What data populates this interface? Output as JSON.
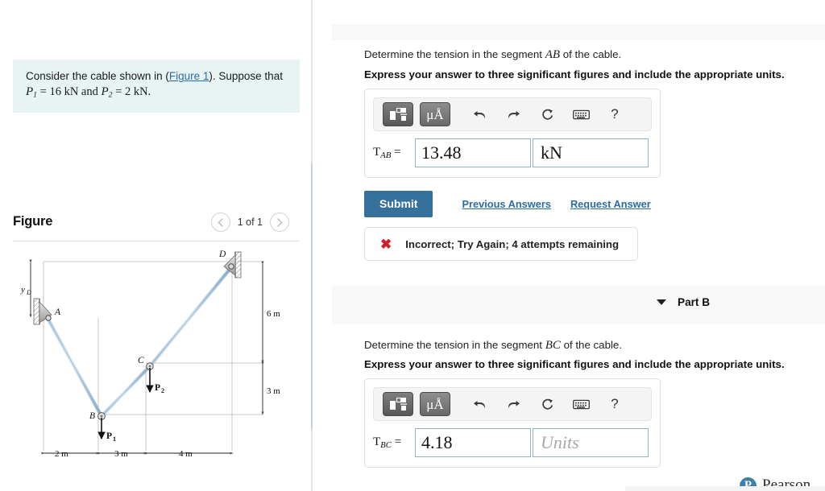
{
  "left": {
    "prompt": {
      "line1_a": "Consider the cable shown in (",
      "link": "Figure 1",
      "line1_b": "). Suppose that",
      "line2_p1": "P",
      "line2_p1_sub": "1",
      "line2_eq1": " = 16 kN and ",
      "line2_p2": "P",
      "line2_p2_sub": "2",
      "line2_eq2": " = 2 kN."
    },
    "figure": {
      "title": "Figure",
      "count": "1 of 1",
      "prev_icon": "chevron-left-icon",
      "next_icon": "chevron-right-icon"
    }
  },
  "diagram": {
    "type": "free-body-cable-diagram",
    "points": {
      "A": "A",
      "B": "B",
      "C": "C",
      "D": "D"
    },
    "forces": {
      "p1": "P",
      "p1_sub": "1",
      "p2": "P",
      "p2_sub": "2"
    },
    "dimensions": {
      "yd": "y",
      "yd_sub": "D",
      "h1": "2 m",
      "h2": "3 m",
      "h3": "4 m",
      "v1": "6 m",
      "v2": "3 m"
    }
  },
  "toolbar": {
    "template_icon": "math-template-icon",
    "units_icon": "micro-angstrom-icon",
    "units_label": "μÅ",
    "undo_icon": "undo-icon",
    "redo_icon": "redo-icon",
    "reset_icon": "reset-icon",
    "keyboard_icon": "keyboard-icon",
    "help_label": "?"
  },
  "part_a": {
    "question": "Determine the tension in the segment AB of the cable.",
    "question_pre": "Determine the tension in the segment ",
    "question_var": "AB",
    "question_post": " of the cable.",
    "instruction": "Express your answer to three significant figures and include the appropriate units.",
    "answer_label_var": "T",
    "answer_label_sub": "AB",
    "answer_label_eq": " =",
    "value": "13.48",
    "units": "kN",
    "submit_label": "Submit",
    "previous_answers_label": "Previous Answers",
    "request_answer_label": "Request Answer",
    "feedback_icon": "incorrect-x-icon",
    "feedback_text": "Incorrect; Try Again; 4 attempts remaining"
  },
  "part_b": {
    "title": "Part B",
    "caret_icon": "caret-down-icon",
    "question_pre": "Determine the tension in the segment ",
    "question_var": "BC",
    "question_post": " of the cable.",
    "instruction": "Express your answer to three significant figures and include the appropriate units.",
    "answer_label_var": "T",
    "answer_label_sub": "BC",
    "answer_label_eq": " =",
    "value": "4.18",
    "units_placeholder": "Units"
  },
  "footer": {
    "brand_mark": "P",
    "brand_name": "Pearson"
  },
  "colors": {
    "prompt_bg": "#e8f4f4",
    "link": "#2b6ca3",
    "submit_bg": "#35719c",
    "error_red": "#cf2128",
    "field_border": "#8fb4c6",
    "band_bg": "#f8f8f8",
    "cable_blue": "#9fc0d8"
  }
}
